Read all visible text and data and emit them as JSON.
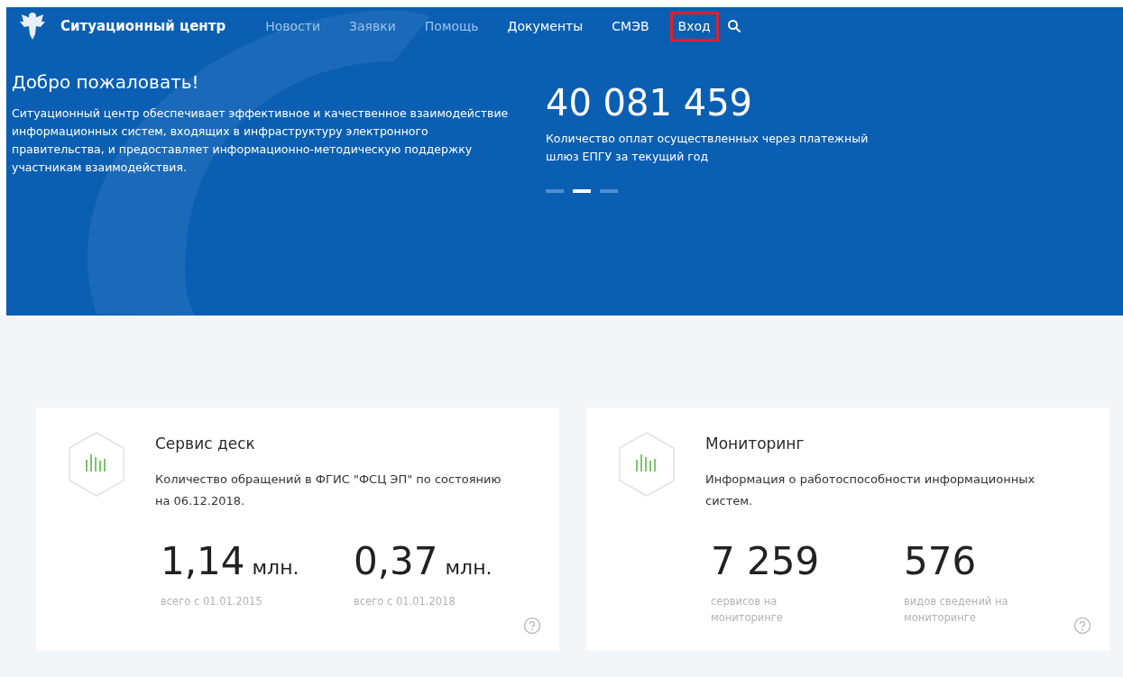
{
  "header": {
    "brand": "Ситуационный центр",
    "nav": [
      {
        "label": "Новости",
        "dimmed": true,
        "highlighted": false
      },
      {
        "label": "Заявки",
        "dimmed": true,
        "highlighted": false
      },
      {
        "label": "Помощь",
        "dimmed": true,
        "highlighted": false
      },
      {
        "label": "Документы",
        "dimmed": false,
        "highlighted": false
      },
      {
        "label": "СМЭВ",
        "dimmed": false,
        "highlighted": false
      },
      {
        "label": "Вход",
        "dimmed": false,
        "highlighted": true
      }
    ]
  },
  "hero": {
    "title": "Добро пожаловать!",
    "text": "Ситуационный центр обеспечивает эффективное и качественное взаимодействие информационных систем, входящих в инфраструктуру электронного правительства, и предоставляет информационно-методическую поддержку участникам взаимодействия.",
    "stat": {
      "value": "40 081 459",
      "caption": "Количество оплат осуществленных через платежный шлюз ЕПГУ за текущий год"
    },
    "slides": [
      {
        "selected": false
      },
      {
        "selected": true
      },
      {
        "selected": false
      }
    ]
  },
  "cards": [
    {
      "title": "Сервис деск",
      "text": "Количество обращений в ФГИС \"ФСЦ ЭП\" по состоянию на 06.12.2018.",
      "stats": [
        {
          "value": "1,14",
          "unit": "млн.",
          "caption": "всего с 01.01.2015"
        },
        {
          "value": "0,37",
          "unit": "млн.",
          "caption": "всего с 01.01.2018"
        }
      ]
    },
    {
      "title": "Мониторинг",
      "text": "Информация о работоспособности информационных систем.",
      "stats": [
        {
          "value": "7 259",
          "caption": "сервисов на мониторинге"
        },
        {
          "value": "576",
          "caption": "видов сведений на мониторинге"
        }
      ]
    }
  ]
}
